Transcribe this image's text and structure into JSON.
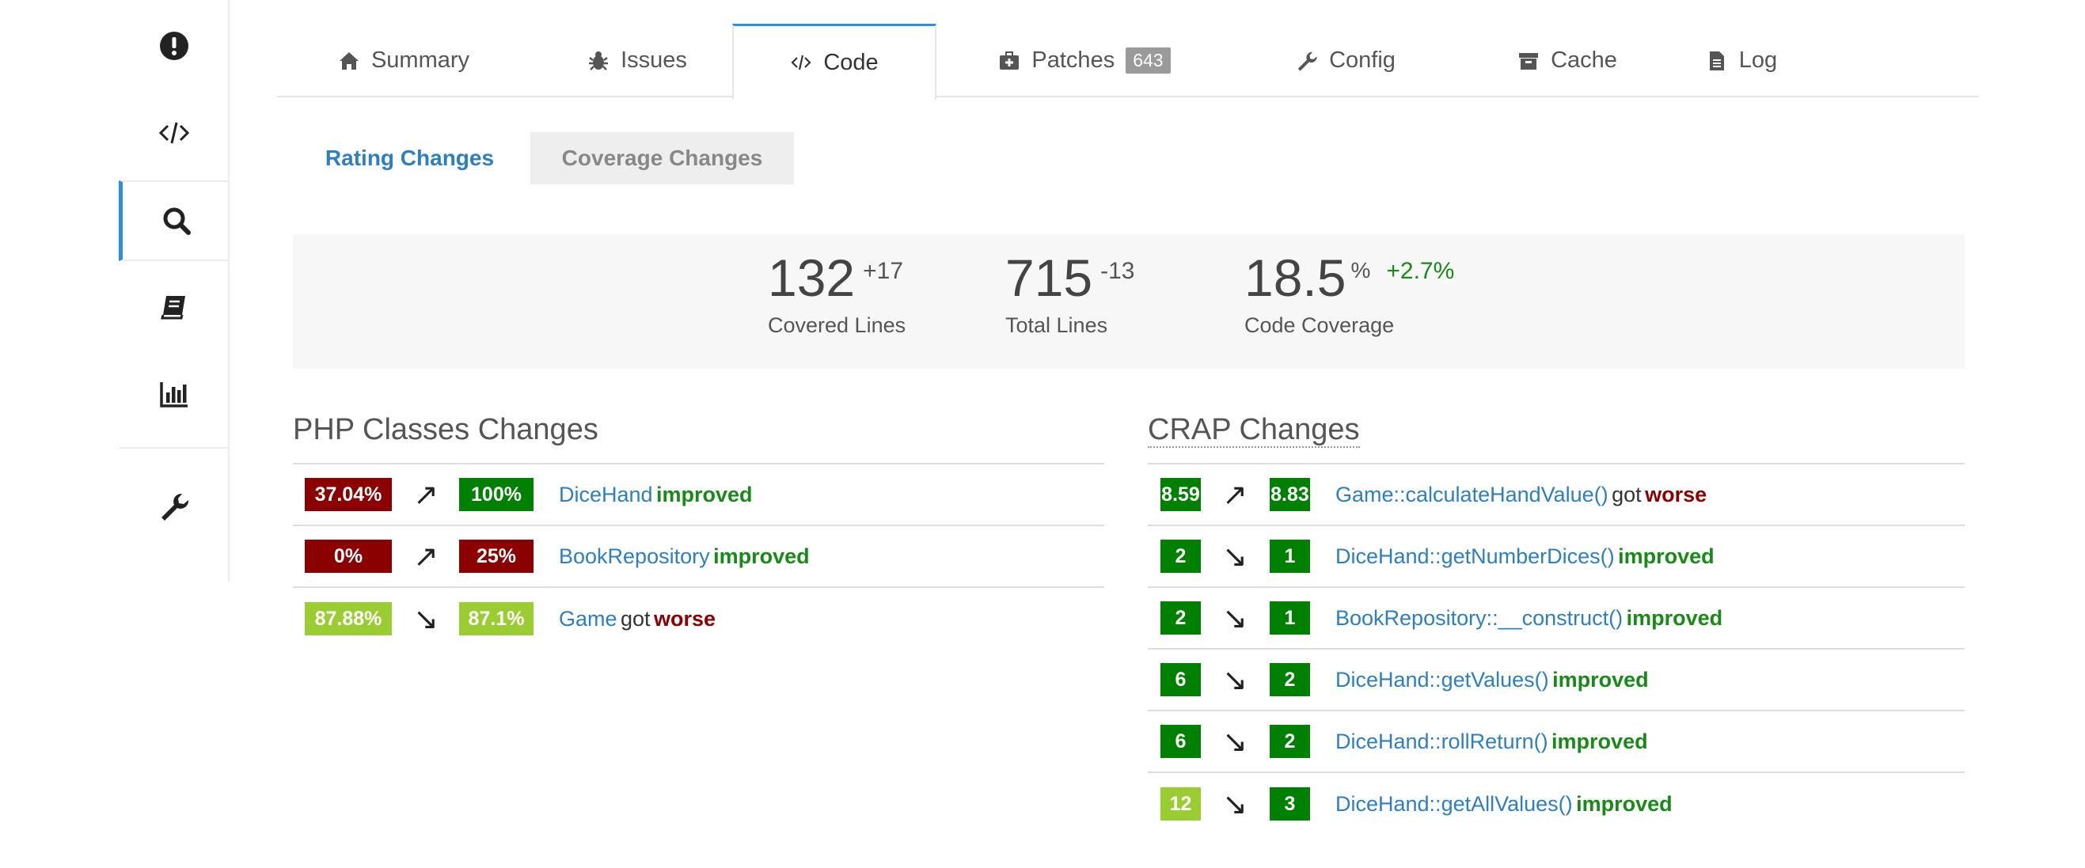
{
  "colors": {
    "accent": "#2d8fd5",
    "red": "#8b0000",
    "green": "#008000",
    "lime": "#9acd32",
    "improved": "#188a18"
  },
  "sidebar": {
    "items": [
      {
        "icon": "exclamation-circle-icon"
      },
      {
        "icon": "code-icon"
      },
      {
        "icon": "search-icon",
        "active": true
      },
      {
        "icon": "book-icon"
      },
      {
        "icon": "bar-chart-icon"
      },
      {
        "icon": "wrench-icon"
      }
    ]
  },
  "tabs": [
    {
      "label": "Summary",
      "icon": "home-icon"
    },
    {
      "label": "Issues",
      "icon": "bug-icon"
    },
    {
      "label": "Code",
      "icon": "code-icon",
      "active": true
    },
    {
      "label": "Patches",
      "icon": "first-aid-icon",
      "badge": "643"
    },
    {
      "label": "Config",
      "icon": "wrench-icon"
    },
    {
      "label": "Cache",
      "icon": "archive-icon"
    },
    {
      "label": "Log",
      "icon": "file-icon"
    }
  ],
  "subtabs": {
    "rating": "Rating Changes",
    "coverage": "Coverage Changes"
  },
  "stats": {
    "covered": {
      "value": "132",
      "delta": "+17",
      "label": "Covered Lines"
    },
    "total": {
      "value": "715",
      "delta": "-13",
      "label": "Total Lines"
    },
    "coverage": {
      "value": "18.5",
      "unit": "%",
      "delta": "+2.7%",
      "label": "Code Coverage"
    }
  },
  "php_classes": {
    "title": "PHP Classes Changes",
    "rows": [
      {
        "from": "37.04%",
        "arrow": "↗",
        "to": "100%",
        "name": "DiceHand",
        "got": "",
        "status": "improved"
      },
      {
        "from": "0%",
        "arrow": "↗",
        "to": "25%",
        "name": "BookRepository",
        "got": "",
        "status": "improved"
      },
      {
        "from": "87.88%",
        "arrow": "↘",
        "to": "87.1%",
        "name": "Game",
        "got": "got",
        "status": "worse"
      }
    ]
  },
  "crap": {
    "title": "CRAP Changes",
    "rows": [
      {
        "from": "8.59",
        "arrow": "↗",
        "to": "8.83",
        "name": "Game::calculateHandValue()",
        "got": "got",
        "status": "worse"
      },
      {
        "from": "2",
        "arrow": "↘",
        "to": "1",
        "name": "DiceHand::getNumberDices()",
        "got": "",
        "status": "improved"
      },
      {
        "from": "2",
        "arrow": "↘",
        "to": "1",
        "name": "BookRepository::__construct()",
        "got": "",
        "status": "improved"
      },
      {
        "from": "6",
        "arrow": "↘",
        "to": "2",
        "name": "DiceHand::getValues()",
        "got": "",
        "status": "improved"
      },
      {
        "from": "6",
        "arrow": "↘",
        "to": "2",
        "name": "DiceHand::rollReturn()",
        "got": "",
        "status": "improved"
      },
      {
        "from": "12",
        "arrow": "↘",
        "to": "3",
        "name": "DiceHand::getAllValues()",
        "got": "",
        "status": "improved"
      }
    ]
  }
}
